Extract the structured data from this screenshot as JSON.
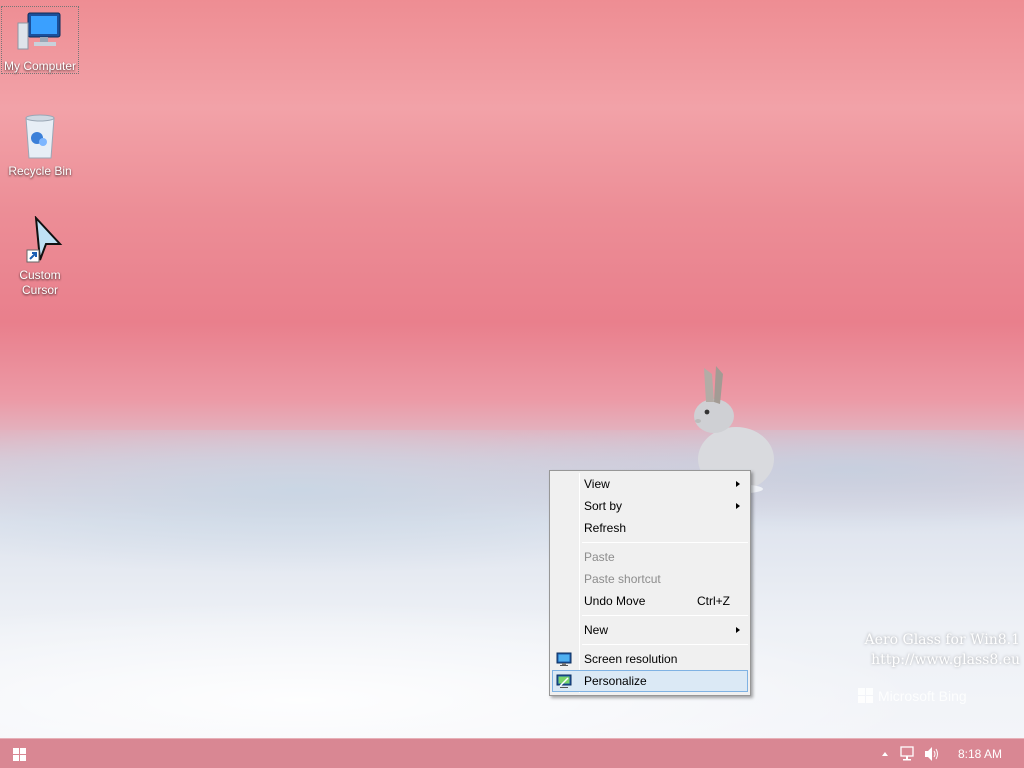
{
  "desktop": {
    "icons": [
      {
        "label": "My Computer"
      },
      {
        "label": "Recycle Bin"
      },
      {
        "label_line1": "Custom",
        "label_line2": "Cursor"
      }
    ],
    "watermark": {
      "line1": "Aero Glass for Win8.1",
      "line2": "http://www.glass8.eu"
    },
    "bing_text": "Microsoft Bing"
  },
  "context_menu": {
    "items": [
      {
        "label": "View",
        "submenu": true,
        "enabled": true
      },
      {
        "label": "Sort by",
        "submenu": true,
        "enabled": true
      },
      {
        "label": "Refresh",
        "enabled": true
      },
      {
        "label": "Paste",
        "enabled": false
      },
      {
        "label": "Paste shortcut",
        "enabled": false
      },
      {
        "label": "Undo Move",
        "shortcut": "Ctrl+Z",
        "enabled": true
      },
      {
        "label": "New",
        "submenu": true,
        "enabled": true
      },
      {
        "label": "Screen resolution",
        "icon": "monitor-icon",
        "enabled": true
      },
      {
        "label": "Personalize",
        "icon": "personalize-icon",
        "enabled": true,
        "highlighted": true
      }
    ]
  },
  "taskbar": {
    "clock": "8:18 AM",
    "tray_icons": [
      "show-hidden-icons-arrow",
      "network-icon",
      "volume-icon"
    ]
  },
  "colors": {
    "menu_bg": "#f0f0f0",
    "menu_highlight": "#dbe9f5",
    "menu_highlight_border": "#7fb2e3",
    "taskbar": "#d67d8a"
  }
}
